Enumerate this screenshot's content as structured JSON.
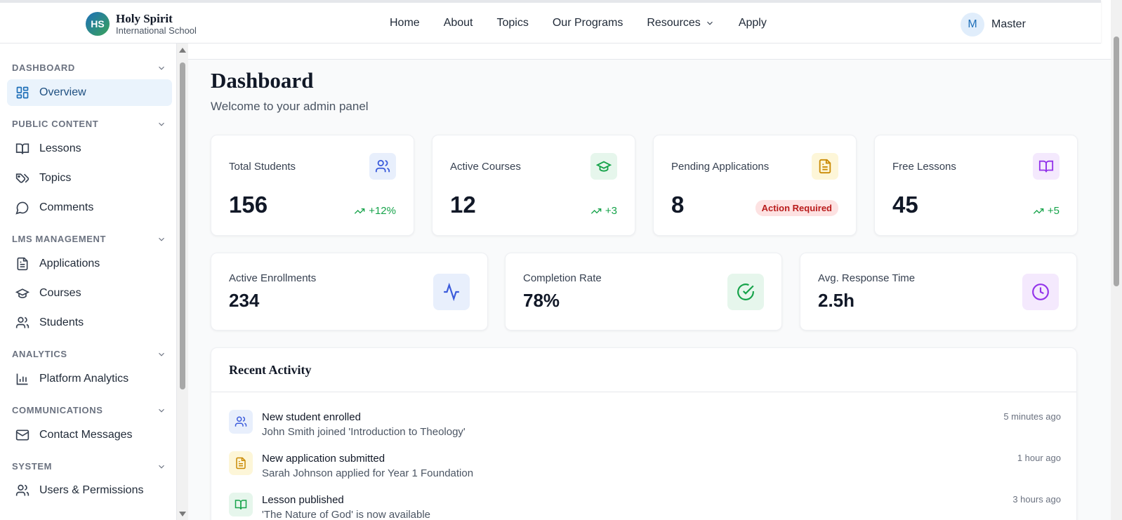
{
  "header": {
    "logo_initials": "HS",
    "logo_title": "Holy Spirit",
    "logo_subtitle": "International School",
    "nav": [
      "Home",
      "About",
      "Topics",
      "Our Programs",
      "Resources",
      "Apply"
    ],
    "user_initial": "M",
    "user_name": "Master"
  },
  "sidebar": {
    "sections": [
      {
        "title": "DASHBOARD",
        "items": [
          {
            "label": "Overview",
            "icon": "layout-grid-icon"
          }
        ]
      },
      {
        "title": "PUBLIC CONTENT",
        "items": [
          {
            "label": "Lessons",
            "icon": "book-open-icon"
          },
          {
            "label": "Topics",
            "icon": "tags-icon"
          },
          {
            "label": "Comments",
            "icon": "message-circle-icon"
          }
        ]
      },
      {
        "title": "LMS MANAGEMENT",
        "items": [
          {
            "label": "Applications",
            "icon": "file-text-icon"
          },
          {
            "label": "Courses",
            "icon": "graduation-cap-icon"
          },
          {
            "label": "Students",
            "icon": "users-icon"
          }
        ]
      },
      {
        "title": "ANALYTICS",
        "items": [
          {
            "label": "Platform Analytics",
            "icon": "bar-chart-icon"
          }
        ]
      },
      {
        "title": "COMMUNICATIONS",
        "items": [
          {
            "label": "Contact Messages",
            "icon": "mail-icon"
          }
        ]
      },
      {
        "title": "SYSTEM",
        "items": [
          {
            "label": "Users & Permissions",
            "icon": "users-icon"
          }
        ]
      }
    ]
  },
  "main": {
    "title": "Dashboard",
    "subtitle": "Welcome to your admin panel",
    "stats": [
      {
        "label": "Total Students",
        "value": "156",
        "trend": "+12%",
        "icon": "users-icon",
        "color": "#3b5bdb"
      },
      {
        "label": "Active Courses",
        "value": "12",
        "trend": "+3",
        "icon": "graduation-cap-icon",
        "color": "#16a34a"
      },
      {
        "label": "Pending Applications",
        "value": "8",
        "badge": "Action Required",
        "icon": "file-text-icon",
        "color": "#ca8a04"
      },
      {
        "label": "Free Lessons",
        "value": "45",
        "trend": "+5",
        "icon": "book-open-icon",
        "color": "#9333ea"
      }
    ],
    "metrics": [
      {
        "label": "Active Enrollments",
        "value": "234",
        "icon": "activity-icon",
        "color": "#3b5bdb"
      },
      {
        "label": "Completion Rate",
        "value": "78%",
        "icon": "check-circle-icon",
        "color": "#16a34a"
      },
      {
        "label": "Avg. Response Time",
        "value": "2.5h",
        "icon": "clock-icon",
        "color": "#9333ea"
      }
    ],
    "activity": {
      "title": "Recent Activity",
      "items": [
        {
          "title": "New student enrolled",
          "desc": "John Smith joined 'Introduction to Theology'",
          "time": "5 minutes ago",
          "icon": "users-icon"
        },
        {
          "title": "New application submitted",
          "desc": "Sarah Johnson applied for Year 1 Foundation",
          "time": "1 hour ago",
          "icon": "file-text-icon"
        },
        {
          "title": "Lesson published",
          "desc": "'The Nature of God' is now available",
          "time": "3 hours ago",
          "icon": "book-open-icon"
        }
      ]
    }
  }
}
